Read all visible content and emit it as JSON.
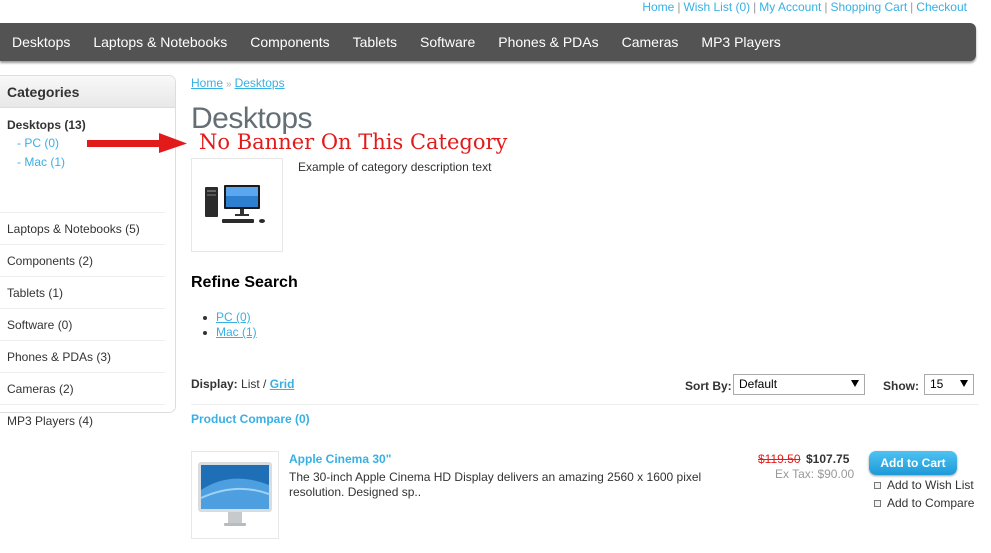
{
  "top_links": {
    "home": "Home",
    "wishlist": "Wish List (0)",
    "account": "My Account",
    "cart": "Shopping Cart",
    "checkout": "Checkout",
    "separator": "|"
  },
  "menu": [
    "Desktops",
    "Laptops & Notebooks",
    "Components",
    "Tablets",
    "Software",
    "Phones & PDAs",
    "Cameras",
    "MP3 Players"
  ],
  "sidebar": {
    "heading": "Categories",
    "active": {
      "label": "Desktops (13)",
      "children": [
        "- PC (0)",
        "- Mac (1)"
      ]
    },
    "items": [
      "Laptops & Notebooks (5)",
      "Components (2)",
      "Tablets (1)",
      "Software (0)",
      "Phones & PDAs (3)",
      "Cameras (2)",
      "MP3 Players (4)"
    ]
  },
  "breadcrumb": {
    "home": "Home",
    "separator": "»",
    "current": "Desktops"
  },
  "page_title": "Desktops",
  "annotation": {
    "text": "No Banner On This Category",
    "color": "#e31a1a"
  },
  "category": {
    "image_icon": "desktop-computer-icon",
    "description": "Example of category description text"
  },
  "refine": {
    "title": "Refine Search",
    "links": [
      "PC (0)",
      "Mac (1)"
    ]
  },
  "toolbar": {
    "display_label": "Display:",
    "display_list": "List",
    "display_sep": " / ",
    "display_grid": "Grid",
    "sort_label": "Sort By:",
    "sort_value": "Default",
    "show_label": "Show:",
    "show_value": "15"
  },
  "product_compare": "Product Compare (0)",
  "products": [
    {
      "name": "Apple Cinema 30\"",
      "description": "The 30-inch Apple Cinema HD Display delivers an amazing 2560 x 1600 pixel resolution. Designed sp..",
      "price_old": "$119.50",
      "price_new": "$107.75",
      "price_tax": "Ex Tax: $90.00",
      "cart_label": "Add to Cart",
      "wish_label": "Add to Wish List",
      "compare_label": "Add to Compare"
    }
  ],
  "colors": {
    "link": "#38b0e3",
    "menu_bg": "#535353",
    "button": "#1e9ad8",
    "price_old": "#e41b1b"
  }
}
